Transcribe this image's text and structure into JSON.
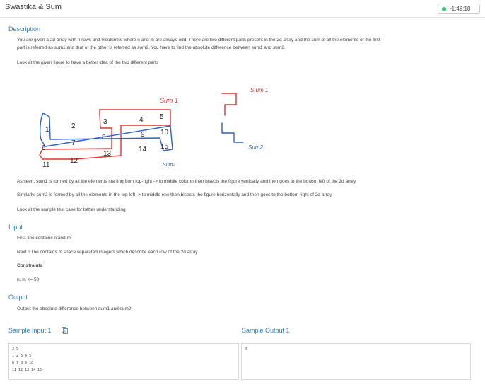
{
  "header": {
    "title": "Swastika & Sum",
    "timer": "-1:49:18",
    "timer_color": "#2ecc71"
  },
  "description": {
    "heading": "Description",
    "p1": "You are given a 2d array with n  rows and mcolumns where n and m are always odd. There are two different parts present in the 2d array and the sum of all the elements of the first",
    "p1b": "part is referred as sum1 and that of the other is referred as sum2. You have to find the absolute difference between sum1 and sum2.",
    "p2": "Look at the given figure to have a better idea of the two different parts",
    "p3": "As seen, sum1 is formed by all the elements starting from top-right -> to middle column then bisects the figure vertically and then goes to the bottom left of the 2d array",
    "p4": "Similarly, sum2 is formed by all the elements in the top left -> to middle row then bisects the figure horizontally and then goes to the bottom right of 2d array",
    "p5": "Look at the sample test case for better understanding"
  },
  "figure": {
    "nums": [
      "1",
      "2",
      "3",
      "4",
      "5",
      "6",
      "7",
      "8",
      "9",
      "10",
      "11",
      "12",
      "13",
      "14",
      "15"
    ],
    "sum1_label": "Sum 1",
    "sum2_label": "Sum2",
    "sum1_small_label": "S um 1",
    "sum2_small_label": "Sum2",
    "sum1_color": "#e0332f",
    "sum2_color": "#2f62c6"
  },
  "input": {
    "heading": "Input",
    "line1": "First line contains n and m",
    "line2": "Next n line contains m space separated integers which describe each row of the 2d array",
    "constraints_heading": "Constraints",
    "constraints": "n, m <= 50"
  },
  "output": {
    "heading": "Output",
    "line1": "Output the absolute difference between sum1 and sum2"
  },
  "sample_input": {
    "heading": "Sample Input 1",
    "lines": [
      "3 5",
      "1 2 3 4 5",
      "6 7 8 9 10",
      "11 12 13 14 15"
    ]
  },
  "sample_output": {
    "heading": "Sample Output 1",
    "lines": [
      "0"
    ]
  }
}
